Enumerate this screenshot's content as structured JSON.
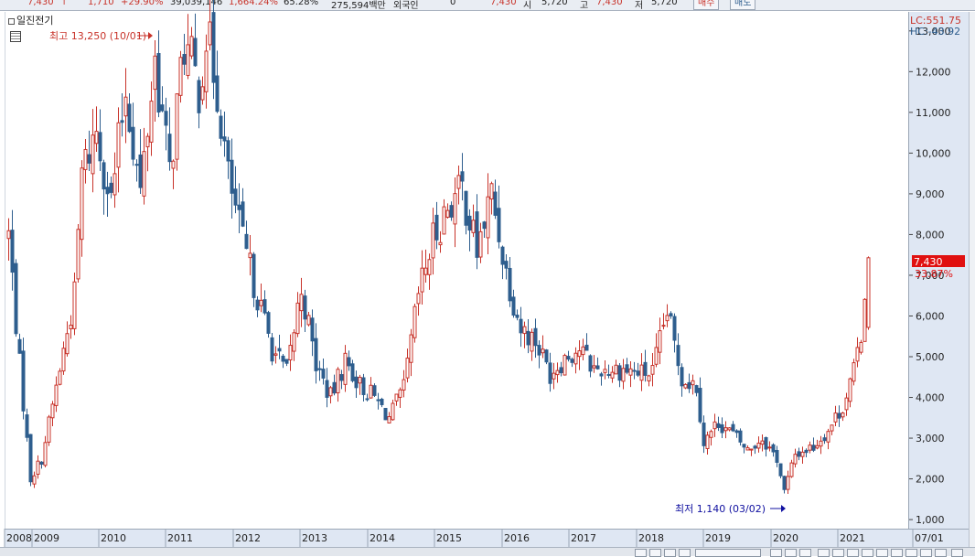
{
  "topbar": {
    "price": "7,430",
    "change": "1,710",
    "change_pct": "+29.90%",
    "volume": "39,039,146",
    "volume_pct": "1,664.24%",
    "ratio": "65.28%",
    "amount": "275,594백만",
    "label_balance": "외국인",
    "balance_value": "0",
    "trade_price": "7,430",
    "label_si": "시",
    "si_value": "5,720",
    "label_go": "고",
    "go_value": "7,430",
    "label_jeo": "저",
    "jeo_value": "5,720",
    "buy_label": "매수",
    "sell_label": "매도"
  },
  "chart": {
    "title": "일진전기",
    "high_label": "최고 13,250 (10/01)",
    "low_label": "최저 1,140 (03/02)",
    "lc_label": "LC:551.75",
    "hc_label": "HC:-43.92",
    "current_price_label": "7,430",
    "current_pct_label": "33.87%",
    "colors": {
      "up": "#c8332a",
      "down": "#2e5e8e",
      "marker": "#e01010",
      "low_arrow": "#1010a0"
    },
    "y_ticks": [
      "1,000",
      "2,000",
      "3,000",
      "4,000",
      "5,000",
      "6,000",
      "7,000",
      "8,000",
      "9,000",
      "10,000",
      "11,000",
      "12,000",
      "13,000"
    ],
    "x_ticks": [
      "2008",
      "2009",
      "2010",
      "2011",
      "2012",
      "2013",
      "2014",
      "2015",
      "2016",
      "2017",
      "2018",
      "2019",
      "2020",
      "2021",
      "07/01"
    ]
  },
  "chart_data": {
    "type": "candlestick",
    "title": "일진전기",
    "ylim": [
      800,
      13400
    ],
    "x": [
      "2008",
      "2009",
      "2010",
      "2011",
      "2012",
      "2013",
      "2014",
      "2015",
      "2016",
      "2017",
      "2018",
      "2019",
      "2020",
      "2021",
      "07/01"
    ],
    "anchors": [
      [
        0,
        8000
      ],
      [
        3,
        4800
      ],
      [
        6,
        2000
      ],
      [
        9,
        2500
      ],
      [
        12,
        3800
      ],
      [
        18,
        6500
      ],
      [
        20,
        9500
      ],
      [
        24,
        10600
      ],
      [
        28,
        8800
      ],
      [
        32,
        11600
      ],
      [
        36,
        9000
      ],
      [
        40,
        12300
      ],
      [
        44,
        9500
      ],
      [
        48,
        12700
      ],
      [
        52,
        11600
      ],
      [
        54,
        12950
      ],
      [
        57,
        11600
      ],
      [
        60,
        9400
      ],
      [
        64,
        7800
      ],
      [
        68,
        6500
      ],
      [
        72,
        5200
      ],
      [
        76,
        4600
      ],
      [
        80,
        6700
      ],
      [
        84,
        4800
      ],
      [
        88,
        4000
      ],
      [
        92,
        4900
      ],
      [
        96,
        4300
      ],
      [
        100,
        4000
      ],
      [
        104,
        3500
      ],
      [
        108,
        4200
      ],
      [
        112,
        6500
      ],
      [
        116,
        7900
      ],
      [
        120,
        8700
      ],
      [
        124,
        9100
      ],
      [
        128,
        7600
      ],
      [
        132,
        9000
      ],
      [
        136,
        7100
      ],
      [
        140,
        5700
      ],
      [
        144,
        5400
      ],
      [
        148,
        4600
      ],
      [
        152,
        5000
      ],
      [
        156,
        5200
      ],
      [
        160,
        4700
      ],
      [
        164,
        4700
      ],
      [
        168,
        4700
      ],
      [
        172,
        4600
      ],
      [
        176,
        4600
      ],
      [
        180,
        6100
      ],
      [
        184,
        4500
      ],
      [
        188,
        4300
      ],
      [
        190,
        2900
      ],
      [
        194,
        3400
      ],
      [
        198,
        3100
      ],
      [
        202,
        2700
      ],
      [
        206,
        3000
      ],
      [
        210,
        2500
      ],
      [
        212,
        1700
      ],
      [
        215,
        2600
      ],
      [
        220,
        2800
      ],
      [
        224,
        3200
      ],
      [
        228,
        3800
      ],
      [
        231,
        4600
      ],
      [
        233,
        5600
      ],
      [
        235,
        7430
      ]
    ]
  }
}
